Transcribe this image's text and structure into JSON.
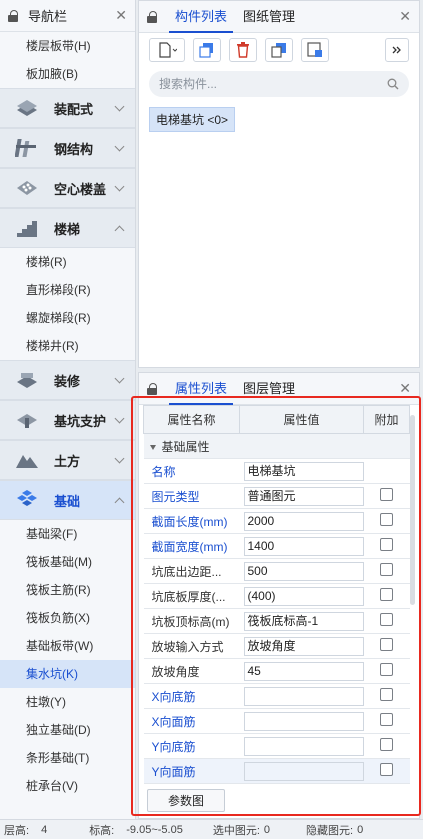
{
  "nav": {
    "title": "导航栏",
    "top_items": [
      "楼层板带(H)",
      "板加腋(B)"
    ],
    "groups": [
      {
        "label": "装配式",
        "icon": "prefab-icon",
        "expanded": false
      },
      {
        "label": "钢结构",
        "icon": "steel-structure-icon",
        "expanded": false
      },
      {
        "label": "空心楼盖",
        "icon": "hollow-slab-icon",
        "expanded": false
      },
      {
        "label": "楼梯",
        "icon": "stairs-icon",
        "expanded": true
      }
    ],
    "stair_items": [
      "楼梯(R)",
      "直形梯段(R)",
      "螺旋梯段(R)",
      "楼梯井(R)"
    ],
    "groups2": [
      {
        "label": "装修",
        "icon": "decoration-icon",
        "expanded": false
      },
      {
        "label": "基坑支护",
        "icon": "pit-support-icon",
        "expanded": false
      },
      {
        "label": "土方",
        "icon": "earthwork-icon",
        "expanded": false
      },
      {
        "label": "基础",
        "icon": "foundation-icon",
        "expanded": true
      }
    ],
    "foundation_items": [
      "基础梁(F)",
      "筏板基础(M)",
      "筏板主筋(R)",
      "筏板负筋(X)",
      "基础板带(W)",
      "集水坑(K)",
      "柱墩(Y)",
      "独立基础(D)",
      "条形基础(T)",
      "桩承台(V)"
    ],
    "selected_item": "集水坑(K)"
  },
  "components": {
    "tabs": [
      "构件列表",
      "图纸管理"
    ],
    "active_tab": "构件列表",
    "search_placeholder": "搜索构件...",
    "items": [
      "电梯基坑 <0>"
    ]
  },
  "properties": {
    "tabs": [
      "属性列表",
      "图层管理"
    ],
    "active_tab": "属性列表",
    "headers": [
      "属性名称",
      "属性值",
      "附加"
    ],
    "group": "基础属性",
    "rows": [
      {
        "name": "名称",
        "value": "电梯基坑",
        "blue": true,
        "checkbox": false
      },
      {
        "name": "图元类型",
        "value": "普通图元",
        "blue": true,
        "checkbox": true
      },
      {
        "name": "截面长度(mm)",
        "value": "2000",
        "blue": true,
        "checkbox": true
      },
      {
        "name": "截面宽度(mm)",
        "value": "1400",
        "blue": true,
        "checkbox": true
      },
      {
        "name": "坑底出边距...",
        "value": "500",
        "blue": false,
        "checkbox": true
      },
      {
        "name": "坑底板厚度(...",
        "value": "(400)",
        "blue": false,
        "checkbox": true
      },
      {
        "name": "坑板顶标高(m)",
        "value": "筏板底标高-1",
        "blue": false,
        "checkbox": true
      },
      {
        "name": "放坡输入方式",
        "value": "放坡角度",
        "blue": false,
        "checkbox": true
      },
      {
        "name": "放坡角度",
        "value": "45",
        "blue": false,
        "checkbox": true
      },
      {
        "name": "X向底筋",
        "value": "",
        "blue": true,
        "checkbox": true
      },
      {
        "name": "X向面筋",
        "value": "",
        "blue": true,
        "checkbox": true
      },
      {
        "name": "Y向底筋",
        "value": "",
        "blue": true,
        "checkbox": true
      },
      {
        "name": "Y向面筋",
        "value": "",
        "blue": true,
        "checkbox": true
      }
    ],
    "param_button": "参数图"
  },
  "status": {
    "floor_label": "层高:",
    "floor_value": "4",
    "elev_label": "标高:",
    "elev_value": "-9.05~-5.05",
    "selected_label": "选中图元:",
    "selected_value": "0",
    "hidden_label": "隐藏图元:",
    "hidden_value": "0"
  }
}
